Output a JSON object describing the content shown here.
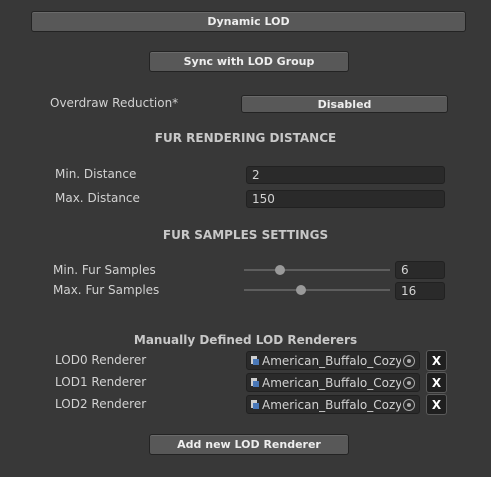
{
  "buttons": {
    "dynamic_lod": "Dynamic LOD",
    "sync_lod_group": "Sync with LOD Group",
    "add_lod_renderer": "Add new LOD Renderer"
  },
  "overdraw": {
    "label": "Overdraw Reduction*",
    "value": "Disabled"
  },
  "fur_rendering_distance": {
    "header": "FUR RENDERING DISTANCE",
    "min_label": "Min. Distance",
    "min_value": "2",
    "max_label": "Max. Distance",
    "max_value": "150"
  },
  "fur_samples": {
    "header": "FUR SAMPLES SETTINGS",
    "min_label": "Min. Fur Samples",
    "min_value": "6",
    "max_label": "Max. Fur Samples",
    "max_value": "16",
    "slider_min": 0,
    "slider_max": 64
  },
  "lod_renderers": {
    "header": "Manually Defined LOD Renderers",
    "items": [
      {
        "label": "LOD0 Renderer",
        "value": "American_Buffalo_Cozy_",
        "remove": "X"
      },
      {
        "label": "LOD1 Renderer",
        "value": "American_Buffalo_Cozy_",
        "remove": "X"
      },
      {
        "label": "LOD2 Renderer",
        "value": "American_Buffalo_Cozy_",
        "remove": "X"
      }
    ]
  },
  "icons": {
    "object": "mesh-renderer-icon",
    "picker": "object-picker-icon",
    "remove": "remove-icon"
  }
}
